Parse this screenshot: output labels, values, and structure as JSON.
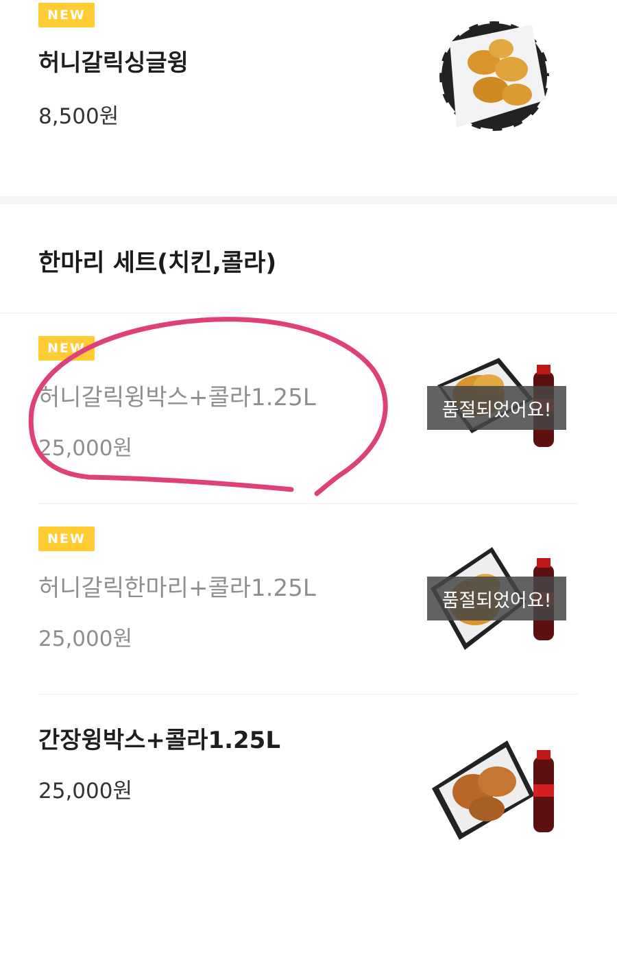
{
  "items_top": {
    "badge": "NEW",
    "name": "허니갈릭싱글윙",
    "price": "8,500원"
  },
  "section": {
    "title": "한마리 세트(치킨,콜라)"
  },
  "set_items": [
    {
      "badge": "NEW",
      "name": "허니갈릭윙박스+콜라1.25L",
      "price": "25,000원",
      "status": "품절되었어요!"
    },
    {
      "badge": "NEW",
      "name": "허니갈릭한마리+콜라1.25L",
      "price": "25,000원",
      "status": "품절되었어요!"
    },
    {
      "name": "간장윙박스+콜라1.25L",
      "price": "25,000원"
    }
  ],
  "colors": {
    "badge": "#ffcc33",
    "annotation": "#e0407a",
    "soldout_bg": "#464646"
  }
}
